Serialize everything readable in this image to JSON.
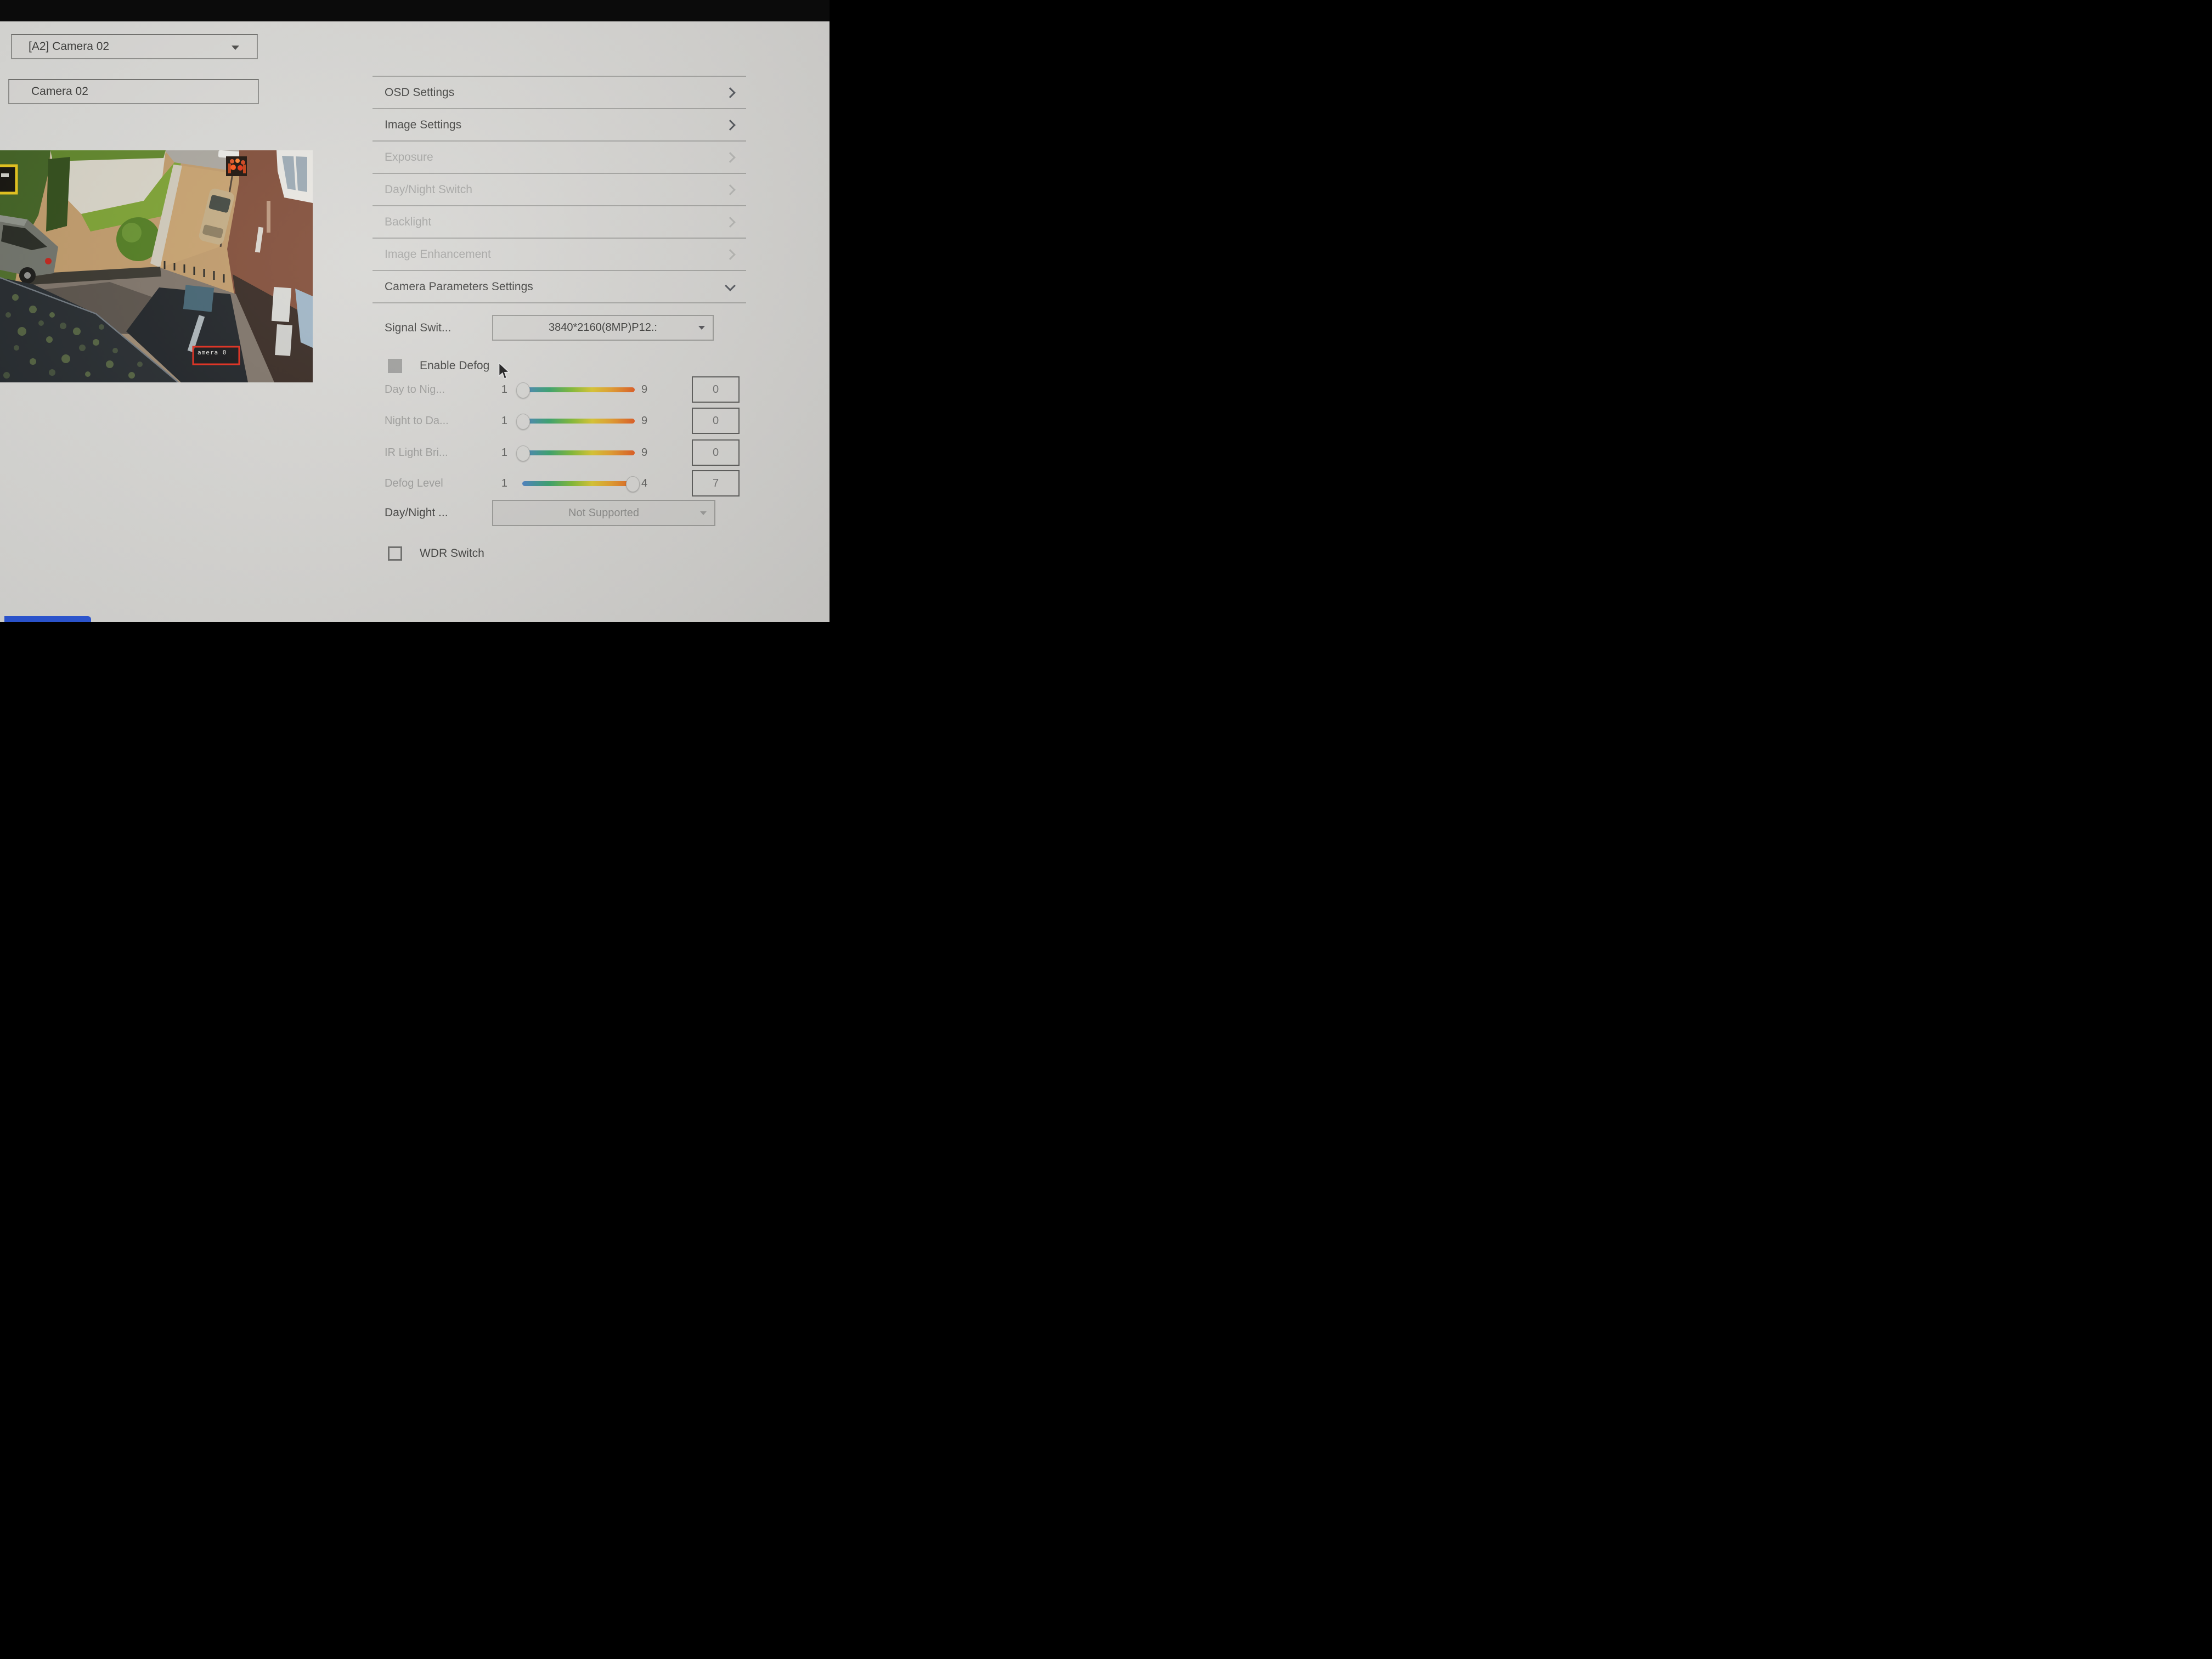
{
  "camera_selector": {
    "value": "[A2] Camera 02"
  },
  "camera_name": {
    "value": "Camera 02"
  },
  "preview": {
    "osd_text": "amera 0"
  },
  "menu": {
    "items": [
      {
        "label": "OSD Settings",
        "enabled": true,
        "chevron": "right"
      },
      {
        "label": "Image Settings",
        "enabled": true,
        "chevron": "right"
      },
      {
        "label": "Exposure",
        "enabled": false,
        "chevron": "right"
      },
      {
        "label": "Day/Night Switch",
        "enabled": false,
        "chevron": "right"
      },
      {
        "label": "Backlight",
        "enabled": false,
        "chevron": "right"
      },
      {
        "label": "Image Enhancement",
        "enabled": false,
        "chevron": "right"
      },
      {
        "label": "Camera Parameters Settings",
        "enabled": true,
        "chevron": "down"
      }
    ]
  },
  "parameters": {
    "signal_switch": {
      "label": "Signal Swit...",
      "value": "3840*2160(8MP)P12.:"
    },
    "enable_defog": {
      "label": "Enable Defog",
      "checked": false
    },
    "sliders": [
      {
        "label": "Day to Nig...",
        "min": "1",
        "max": "9",
        "value": "0",
        "thumb": "start"
      },
      {
        "label": "Night to Da...",
        "min": "1",
        "max": "9",
        "value": "0",
        "thumb": "start"
      },
      {
        "label": "IR Light Bri...",
        "min": "1",
        "max": "9",
        "value": "0",
        "thumb": "start"
      },
      {
        "label": "Defog Level",
        "min": "1",
        "max": "4",
        "value": "7",
        "thumb": "end"
      }
    ],
    "day_night": {
      "label": "Day/Night ...",
      "value": "Not Supported"
    },
    "wdr": {
      "label": "WDR Switch",
      "checked": false
    }
  },
  "colors": {
    "accent_blue": "#2b56d6",
    "overlay_red": "#e02818",
    "overlay_yellow": "#e6c419",
    "slider_gradient": [
      "#4a7ec0",
      "#35a06a",
      "#7fb832",
      "#d7c42e",
      "#e29b2b",
      "#dd5a1f"
    ]
  }
}
